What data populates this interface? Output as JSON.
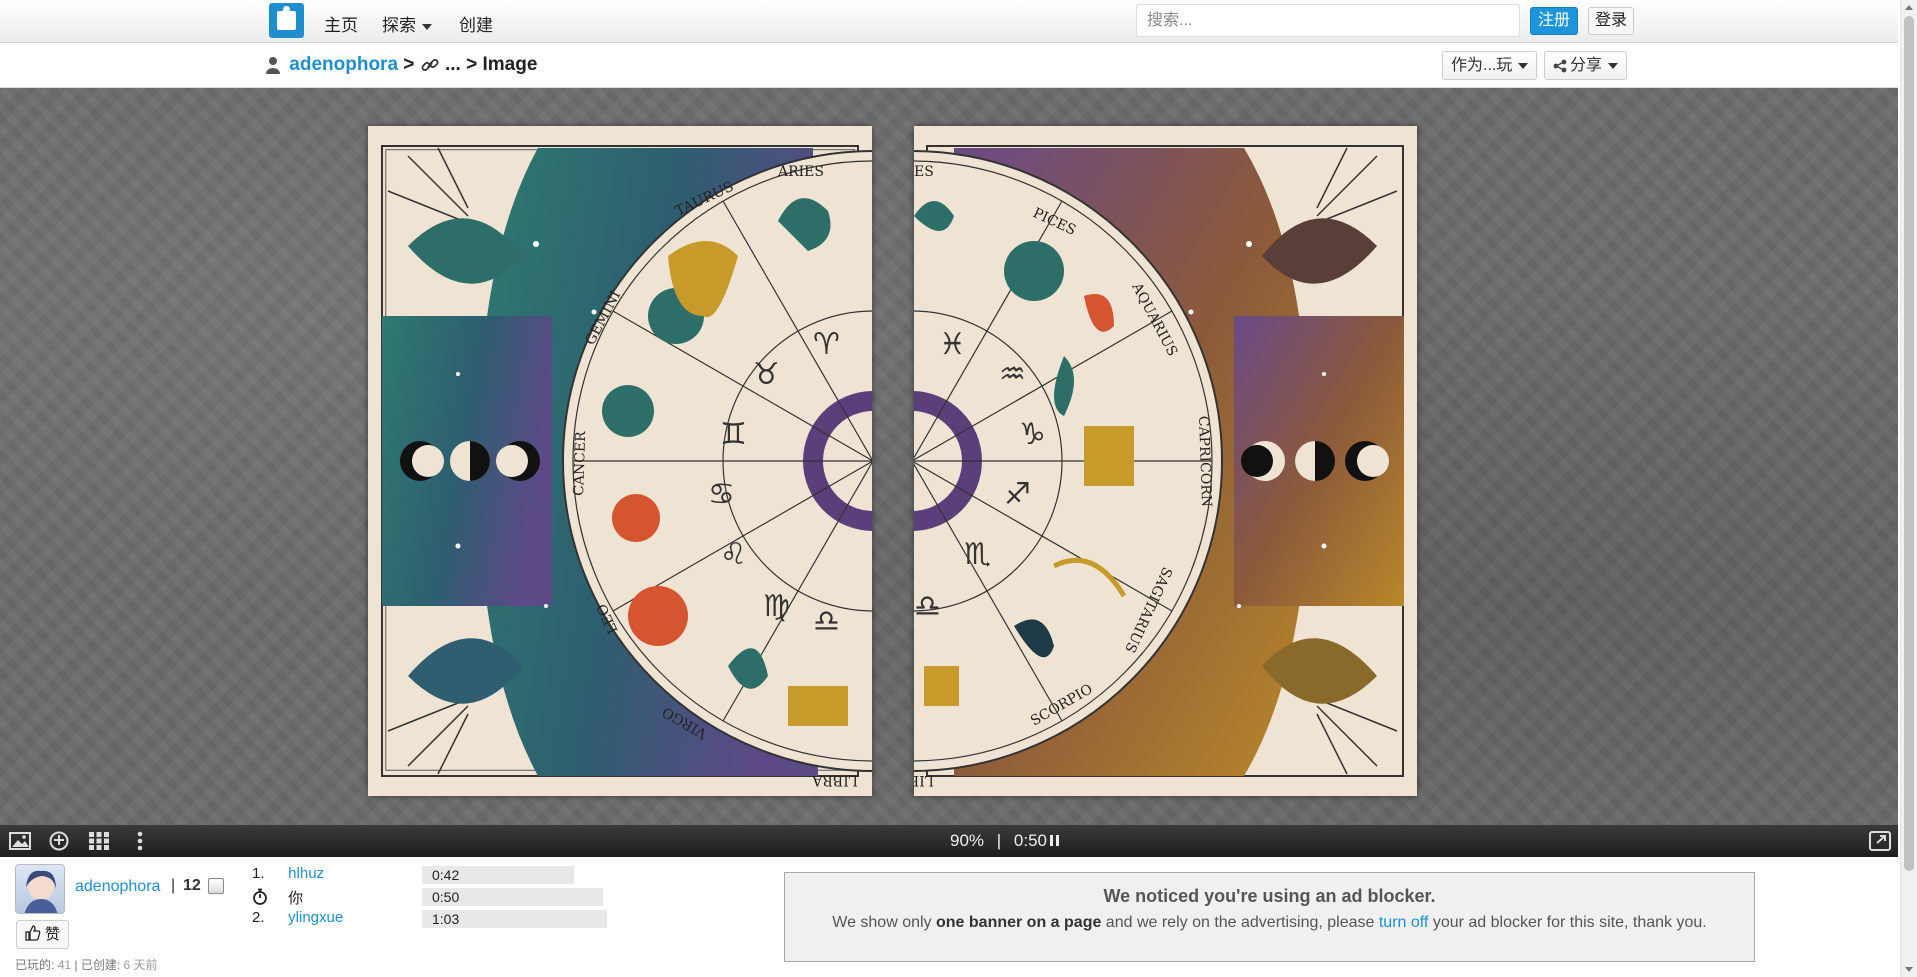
{
  "nav": {
    "home": "主页",
    "explore": "探索",
    "create": "创建",
    "search_placeholder": "搜索...",
    "signup": "注册",
    "login": "登录"
  },
  "breadcrumb": {
    "user": "adenophora",
    "sep1": ">",
    "ellipsis": "...",
    "sep2": ">",
    "current": "Image"
  },
  "actions": {
    "play_as": "作为...玩",
    "share": "分享"
  },
  "status": {
    "progress": "90%",
    "divider": "|",
    "timer": "0:50"
  },
  "author": {
    "name": "adenophora",
    "separator": "|",
    "puzzle_count": "12",
    "like_label": "赞",
    "played_label": "已玩的:",
    "played_value": "41",
    "stats_sep": "|",
    "created_label": "已创建:",
    "created_value": "6 天前"
  },
  "scoreboard": [
    {
      "rank": "1.",
      "name": "hlhuz",
      "time": "0:42",
      "bar": 0.82
    },
    {
      "rank": "",
      "name": "你",
      "time": "0:50",
      "bar": 0.98
    },
    {
      "rank": "2.",
      "name": "ylingxue",
      "time": "1:03",
      "bar": 1.0
    }
  ],
  "ad": {
    "title": "We noticed you're using an ad blocker.",
    "text_before": "We show only ",
    "text_bold": "one banner on a page",
    "text_mid": " and we rely on the advertising, please ",
    "text_link": "turn off",
    "text_after": " your ad blocker for this site, thank you."
  },
  "puzzle_image": {
    "zodiac_labels": [
      "TAURUS",
      "ARIES",
      "GEMINI",
      "CANCER",
      "LEO",
      "VIRGO",
      "LIBRA",
      "PICES",
      "AQUARIUS",
      "CAPRICORN",
      "SAGITARIUS",
      "SCORPIO"
    ]
  },
  "colors": {
    "accent": "#1e8ecf",
    "teal": "#2f7a72",
    "purple": "#6a4a86",
    "gold": "#b8882a",
    "cream": "#efe4d3"
  },
  "icons": [
    "image-icon",
    "ghost-icon",
    "grid-icon",
    "more-icon",
    "fullscreen-icon",
    "like-icon",
    "user-icon",
    "link-icon"
  ]
}
